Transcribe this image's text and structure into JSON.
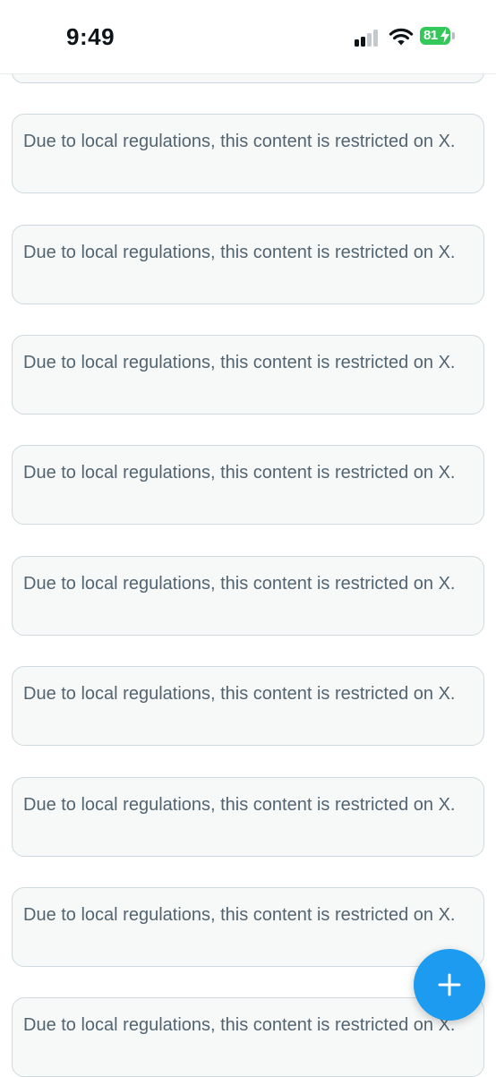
{
  "status_bar": {
    "time": "9:49",
    "battery_level": "81",
    "battery_color": "#34c759",
    "charging": true,
    "signal_bars_active": 2,
    "signal_bars_total": 4
  },
  "feed": {
    "notices": [
      {
        "text": "Due to local regulations, this content is restricted on X."
      },
      {
        "text": "Due to local regulations, this content is restricted on X."
      },
      {
        "text": "Due to local regulations, this content is restricted on X."
      },
      {
        "text": "Due to local regulations, this content is restricted on X."
      },
      {
        "text": "Due to local regulations, this content is restricted on X."
      },
      {
        "text": "Due to local regulations, this content is restricted on X."
      },
      {
        "text": "Due to local regulations, this content is restricted on X."
      },
      {
        "text": "Due to local regulations, this content is restricted on X."
      },
      {
        "text": "Due to local regulations, this content is restricted on X."
      }
    ]
  },
  "compose_button": {
    "icon": "plus-icon",
    "color": "#1d9bf0"
  }
}
